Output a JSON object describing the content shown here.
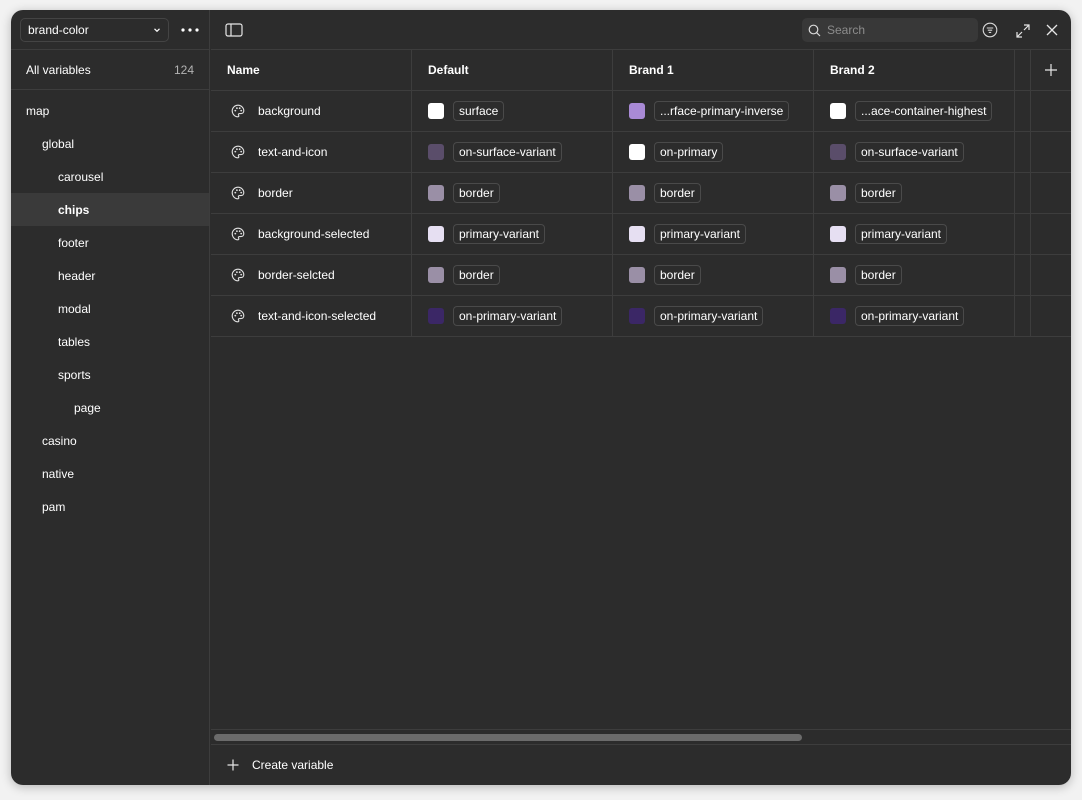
{
  "sidebar": {
    "collection": "brand-color",
    "all_variables": {
      "label": "All variables",
      "count": "124"
    },
    "groups": [
      {
        "label": "map",
        "level": 0
      },
      {
        "label": "global",
        "level": 1
      },
      {
        "label": "carousel",
        "level": 2
      },
      {
        "label": "chips",
        "level": 2,
        "active": true
      },
      {
        "label": "footer",
        "level": 2
      },
      {
        "label": "header",
        "level": 2
      },
      {
        "label": "modal",
        "level": 2
      },
      {
        "label": "tables",
        "level": 2
      },
      {
        "label": "sports",
        "level": 2
      },
      {
        "label": "page",
        "level": 3
      },
      {
        "label": "casino",
        "level": 1
      },
      {
        "label": "native",
        "level": 1
      },
      {
        "label": "pam",
        "level": 1
      }
    ]
  },
  "toolbar": {
    "search_placeholder": "Search"
  },
  "table": {
    "columns": [
      "Name",
      "Default",
      "Brand 1",
      "Brand 2"
    ],
    "rows": [
      {
        "name": "background",
        "values": [
          {
            "color": "#ffffff",
            "alias": "surface"
          },
          {
            "color": "#a98ad6",
            "alias": "...rface-primary-inverse"
          },
          {
            "color": "#ffffff",
            "alias": "...ace-container-highest"
          }
        ]
      },
      {
        "name": "text-and-icon",
        "values": [
          {
            "color": "#5a4d6a",
            "alias": "on-surface-variant"
          },
          {
            "color": "#ffffff",
            "alias": "on-primary"
          },
          {
            "color": "#5a4d6a",
            "alias": "on-surface-variant"
          }
        ]
      },
      {
        "name": "border",
        "values": [
          {
            "color": "#9a8fa6",
            "alias": "border"
          },
          {
            "color": "#9a8fa6",
            "alias": "border"
          },
          {
            "color": "#9a8fa6",
            "alias": "border"
          }
        ]
      },
      {
        "name": "background-selected",
        "values": [
          {
            "color": "#e6dff2",
            "alias": "primary-variant"
          },
          {
            "color": "#e6dff2",
            "alias": "primary-variant"
          },
          {
            "color": "#e6dff2",
            "alias": "primary-variant"
          }
        ]
      },
      {
        "name": "border-selcted",
        "values": [
          {
            "color": "#9a8fa6",
            "alias": "border"
          },
          {
            "color": "#9a8fa6",
            "alias": "border"
          },
          {
            "color": "#9a8fa6",
            "alias": "border"
          }
        ]
      },
      {
        "name": "text-and-icon-selected",
        "values": [
          {
            "color": "#3b2766",
            "alias": "on-primary-variant"
          },
          {
            "color": "#3b2766",
            "alias": "on-primary-variant"
          },
          {
            "color": "#3b2766",
            "alias": "on-primary-variant"
          }
        ]
      }
    ]
  },
  "footer": {
    "create_label": "Create variable"
  }
}
